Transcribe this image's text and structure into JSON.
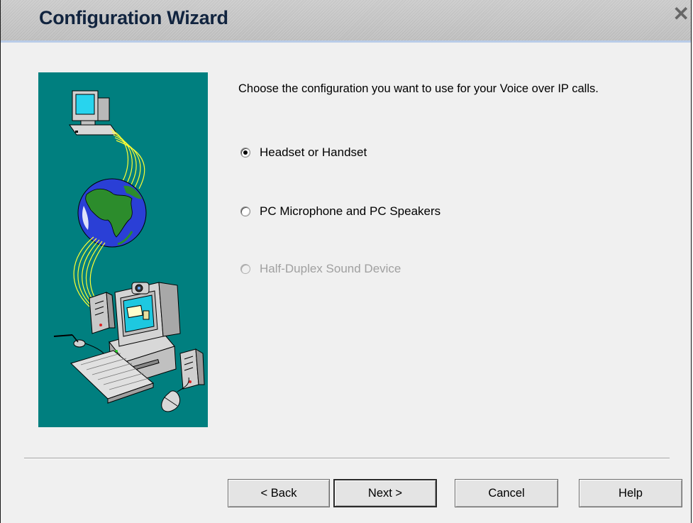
{
  "window": {
    "title": "Configuration Wizard",
    "close_glyph": "✕"
  },
  "content": {
    "prompt": "Choose the configuration you want to use for your Voice over IP calls.",
    "options": [
      {
        "label": "Headset or Handset",
        "selected": true,
        "enabled": true
      },
      {
        "label": "PC Microphone and PC Speakers",
        "selected": false,
        "enabled": true
      },
      {
        "label": "Half-Duplex Sound Device",
        "selected": false,
        "enabled": false
      }
    ]
  },
  "buttons": {
    "back": "< Back",
    "next": "Next >",
    "cancel": "Cancel",
    "help": "Help"
  },
  "illustration": {
    "background_color": "#007f7f",
    "icons": [
      "monitor-icon",
      "globe-icon",
      "desktop-computer-icon",
      "keyboard-icon",
      "mouse-icon",
      "speaker-icon",
      "microphone-icon",
      "webcam-icon"
    ]
  }
}
